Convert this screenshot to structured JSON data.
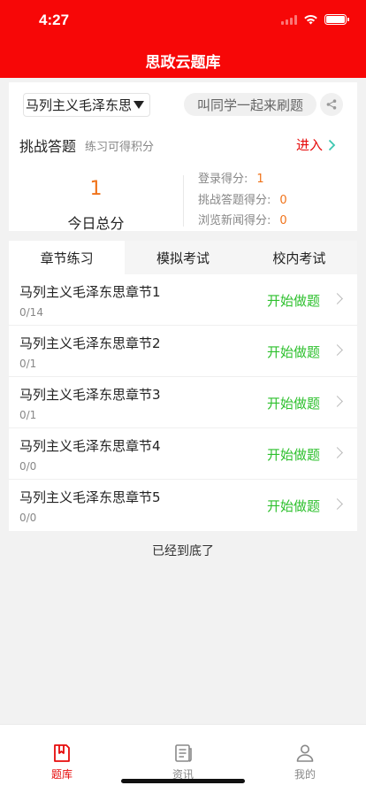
{
  "status_bar": {
    "time": "4:27"
  },
  "header": {
    "title": "思政云题库"
  },
  "subject_select": {
    "value": "马列主义毛泽东思"
  },
  "invite": {
    "label": "叫同学一起来刷题"
  },
  "challenge": {
    "title": "挑战答题",
    "subtitle": "练习可得积分",
    "enter_label": "进入"
  },
  "score": {
    "total": "1",
    "total_label": "今日总分",
    "items": [
      {
        "label": "登录得分:",
        "value": "1"
      },
      {
        "label": "挑战答题得分:",
        "value": "0"
      },
      {
        "label": "浏览新闻得分:",
        "value": "0"
      }
    ]
  },
  "tabs": [
    {
      "label": "章节练习",
      "active": true
    },
    {
      "label": "模拟考试",
      "active": false
    },
    {
      "label": "校内考试",
      "active": false
    }
  ],
  "chapters": [
    {
      "name": "马列主义毛泽东思章节1",
      "progress": "0/14",
      "action": "开始做题"
    },
    {
      "name": "马列主义毛泽东思章节2",
      "progress": "0/1",
      "action": "开始做题"
    },
    {
      "name": "马列主义毛泽东思章节3",
      "progress": "0/1",
      "action": "开始做题"
    },
    {
      "name": "马列主义毛泽东思章节4",
      "progress": "0/0",
      "action": "开始做题"
    },
    {
      "name": "马列主义毛泽东思章节5",
      "progress": "0/0",
      "action": "开始做题"
    }
  ],
  "end_text": "已经到底了",
  "tabbar": [
    {
      "label": "题库",
      "icon": "question-bank-icon",
      "active": true
    },
    {
      "label": "资讯",
      "icon": "news-icon",
      "active": false
    },
    {
      "label": "我的",
      "icon": "user-icon",
      "active": false
    }
  ],
  "colors": {
    "brand": "#f70707",
    "accent_orange": "#f0731a",
    "start_green": "#2dc02d",
    "enter_red": "#e60b0b",
    "enter_arrow": "#3cc6b0"
  }
}
